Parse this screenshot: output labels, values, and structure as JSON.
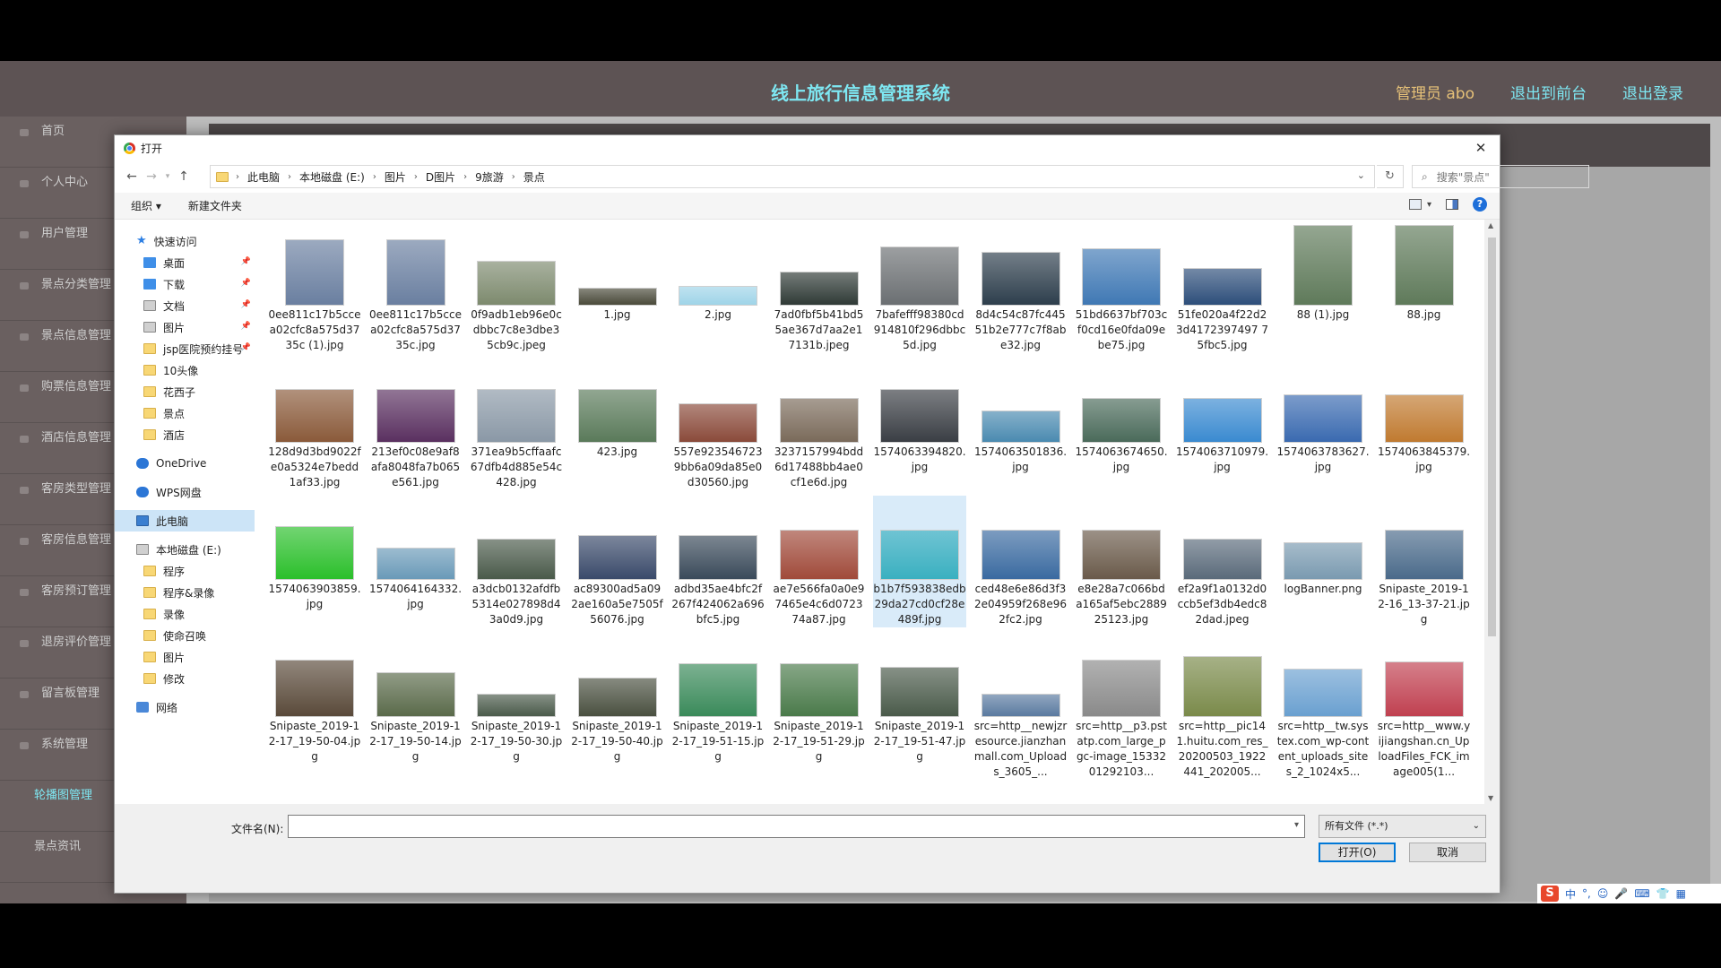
{
  "app": {
    "title": "线上旅行信息管理系统",
    "admin": "管理员 abo",
    "to_front": "退出到前台",
    "logout": "退出登录",
    "sidebar": [
      "首页",
      "个人中心",
      "用户管理",
      "景点分类管理",
      "景点信息管理",
      "购票信息管理",
      "酒店信息管理",
      "客房类型管理",
      "客房信息管理",
      "客房预订管理",
      "退房评价管理",
      "留言板管理",
      "系统管理",
      "轮播图管理",
      "景点资讯"
    ],
    "active_item": "轮播图管理",
    "accent_color": "#7ee7f2"
  },
  "dialog": {
    "title": "打开",
    "close_glyph": "✕",
    "breadcrumb": [
      "此电脑",
      "本地磁盘 (E:)",
      "图片",
      "D图片",
      "9旅游",
      "景点"
    ],
    "search_placeholder": "搜索\"景点\"",
    "organize": "组织 ▾",
    "new_folder": "新建文件夹",
    "help": "?",
    "nav_pane": {
      "quick_access": "快速访问",
      "quick_items": [
        "桌面",
        "下载",
        "文档",
        "图片",
        "jsp医院预约挂号",
        "10头像",
        "花西子",
        "景点",
        "酒店"
      ],
      "onedrive": "OneDrive",
      "wps": "WPS网盘",
      "this_pc": "此电脑",
      "drive": "本地磁盘 (E:)",
      "drive_items": [
        "程序",
        "程序&录像",
        "录像",
        "使命召唤",
        "图片",
        "修改"
      ],
      "network": "网络"
    },
    "files": [
      {
        "name": "0ee811c17b5ccea02cfc8a575d3735c (1).jpg",
        "w": 66,
        "h": 74,
        "c": "#6a7fa0"
      },
      {
        "name": "0ee811c17b5ccea02cfc8a575d3735c.jpg",
        "w": 66,
        "h": 74,
        "c": "#6a7fa0"
      },
      {
        "name": "0f9adb1eb96e0cdbbc7c8e3dbe35cb9c.jpeg",
        "w": 88,
        "h": 50,
        "c": "#7d8a6e"
      },
      {
        "name": "1.jpg",
        "w": 88,
        "h": 20,
        "c": "#4a4a3a"
      },
      {
        "name": "2.jpg",
        "w": 88,
        "h": 22,
        "c": "#9fd4e8"
      },
      {
        "name": "7ad0fbf5b41bd55ae367d7aa2e17131b.jpeg",
        "w": 88,
        "h": 38,
        "c": "#2f3a36"
      },
      {
        "name": "7bafefff98380cd914810f296dbbc5d.jpg",
        "w": 88,
        "h": 66,
        "c": "#6b6f72"
      },
      {
        "name": "8d4c54c87fc44551b2e777c7f8abe32.jpg",
        "w": 88,
        "h": 60,
        "c": "#2d3e4c"
      },
      {
        "name": "51bd6637bf703cf0cd16e0fda09ebe75.jpg",
        "w": 88,
        "h": 64,
        "c": "#3f78b4"
      },
      {
        "name": "51fe020a4f22d23d4172397497 75fbc5.jpg",
        "w": 88,
        "h": 42,
        "c": "#2d4e7a"
      },
      {
        "name": "88 (1).jpg",
        "w": 66,
        "h": 90,
        "c": "#5f7a5a"
      },
      {
        "name": "88.jpg",
        "w": 66,
        "h": 90,
        "c": "#5f7a5a"
      },
      {
        "name": "128d9d3bd9022fe0a5324e7bedd1af33.jpg",
        "w": 88,
        "h": 60,
        "c": "#8a5a3a"
      },
      {
        "name": "213ef0c08e9af8afa8048fa7b065e561.jpg",
        "w": 88,
        "h": 60,
        "c": "#5a3060"
      },
      {
        "name": "371ea9b5cffaafc67dfb4d885e54c428.jpg",
        "w": 88,
        "h": 60,
        "c": "#8a98a6"
      },
      {
        "name": "423.jpg",
        "w": 88,
        "h": 60,
        "c": "#5a7a5a"
      },
      {
        "name": "557e923546723 9bb6a09da85e0d30560.jpg",
        "w": 88,
        "h": 44,
        "c": "#8a4a3a"
      },
      {
        "name": "3237157994bdd6d17488bb4ae0cf1e6d.jpg",
        "w": 88,
        "h": 50,
        "c": "#7a6a5a"
      },
      {
        "name": "1574063394820.jpg",
        "w": 88,
        "h": 60,
        "c": "#3a3e44"
      },
      {
        "name": "1574063501836.jpg",
        "w": 88,
        "h": 36,
        "c": "#4a8ab0"
      },
      {
        "name": "1574063674650.jpg",
        "w": 88,
        "h": 50,
        "c": "#4a6a5a"
      },
      {
        "name": "1574063710979.jpg",
        "w": 88,
        "h": 50,
        "c": "#3a8ad0"
      },
      {
        "name": "1574063783627.jpg",
        "w": 88,
        "h": 54,
        "c": "#3a6ab0"
      },
      {
        "name": "1574063845379.jpg",
        "w": 88,
        "h": 54,
        "c": "#c07a30"
      },
      {
        "name": "1574063903859.jpg",
        "w": 88,
        "h": 60,
        "c": "#2bbf2b"
      },
      {
        "name": "1574064164332.jpg",
        "w": 88,
        "h": 36,
        "c": "#6a9ab8"
      },
      {
        "name": "a3dcb0132afdfb5314e027898d43a0d9.jpg",
        "w": 88,
        "h": 46,
        "c": "#4a5a4a"
      },
      {
        "name": "ac89300ad5a092ae160a5e7505f56076.jpg",
        "w": 88,
        "h": 50,
        "c": "#3a4a6a"
      },
      {
        "name": "adbd35ae4bfc2f267f424062a696bfc5.jpg",
        "w": 88,
        "h": 50,
        "c": "#3a4a5a"
      },
      {
        "name": "ae7e566fa0a0e97465e4c6d072374a87.jpg",
        "w": 88,
        "h": 56,
        "c": "#a04a3a"
      },
      {
        "name": "b1b7f593838edb29da27cd0cf28e489f.jpg",
        "w": 88,
        "h": 56,
        "c": "#3ab0c0",
        "selected": true
      },
      {
        "name": "ced48e6e86d3f32e04959f268e962fc2.jpg",
        "w": 88,
        "h": 56,
        "c": "#3a6aa0"
      },
      {
        "name": "e8e28a7c066bda165af5ebc288925123.jpg",
        "w": 88,
        "h": 56,
        "c": "#6a5a4a"
      },
      {
        "name": "ef2a9f1a0132d0ccb5ef3db4edc82dad.jpeg",
        "w": 88,
        "h": 46,
        "c": "#5a6a7a"
      },
      {
        "name": "logBanner.png",
        "w": 88,
        "h": 42,
        "c": "#7a9ab0"
      },
      {
        "name": "Snipaste_2019-12-16_13-37-21.jpg",
        "w": 88,
        "h": 56,
        "c": "#4a6a8a"
      },
      {
        "name": "Snipaste_2019-12-17_19-50-04.jpg",
        "w": 88,
        "h": 64,
        "c": "#5a4a3a"
      },
      {
        "name": "Snipaste_2019-12-17_19-50-14.jpg",
        "w": 88,
        "h": 50,
        "c": "#5a6a4a"
      },
      {
        "name": "Snipaste_2019-12-17_19-50-30.jpg",
        "w": 88,
        "h": 26,
        "c": "#4a5a4a"
      },
      {
        "name": "Snipaste_2019-12-17_19-50-40.jpg",
        "w": 88,
        "h": 44,
        "c": "#4a5040"
      },
      {
        "name": "Snipaste_2019-12-17_19-51-15.jpg",
        "w": 88,
        "h": 60,
        "c": "#3a8a5a"
      },
      {
        "name": "Snipaste_2019-12-17_19-51-29.jpg",
        "w": 88,
        "h": 60,
        "c": "#4a7a4a"
      },
      {
        "name": "Snipaste_2019-12-17_19-51-47.jpg",
        "w": 88,
        "h": 56,
        "c": "#4a5a4a"
      },
      {
        "name": "src=http__newjzresource.jianzhanmall.com_Uploads_3605_...",
        "w": 88,
        "h": 26,
        "c": "#5a7aa0"
      },
      {
        "name": "src=http__p3.pstatp.com_large_pgc-image_1533201292103...",
        "w": 88,
        "h": 64,
        "c": "#8a8a8a"
      },
      {
        "name": "src=http__pic141.huitu.com_res_20200503_1922441_202005...",
        "w": 88,
        "h": 68,
        "c": "#7a8a4a"
      },
      {
        "name": "src=http__tw.systex.com_wp-content_uploads_sites_2_1024x5...",
        "w": 88,
        "h": 54,
        "c": "#6aa0d0"
      },
      {
        "name": "src=http__www.yijiangshan.cn_UploadFiles_FCK_image005(1...",
        "w": 88,
        "h": 62,
        "c": "#c04050"
      }
    ],
    "filename_label": "文件名(N):",
    "filename_value": "",
    "filetype": "所有文件 (*.*)",
    "open_btn": "打开(O)",
    "cancel_btn": "取消"
  },
  "ime": {
    "logo": "S",
    "mode": "中"
  }
}
